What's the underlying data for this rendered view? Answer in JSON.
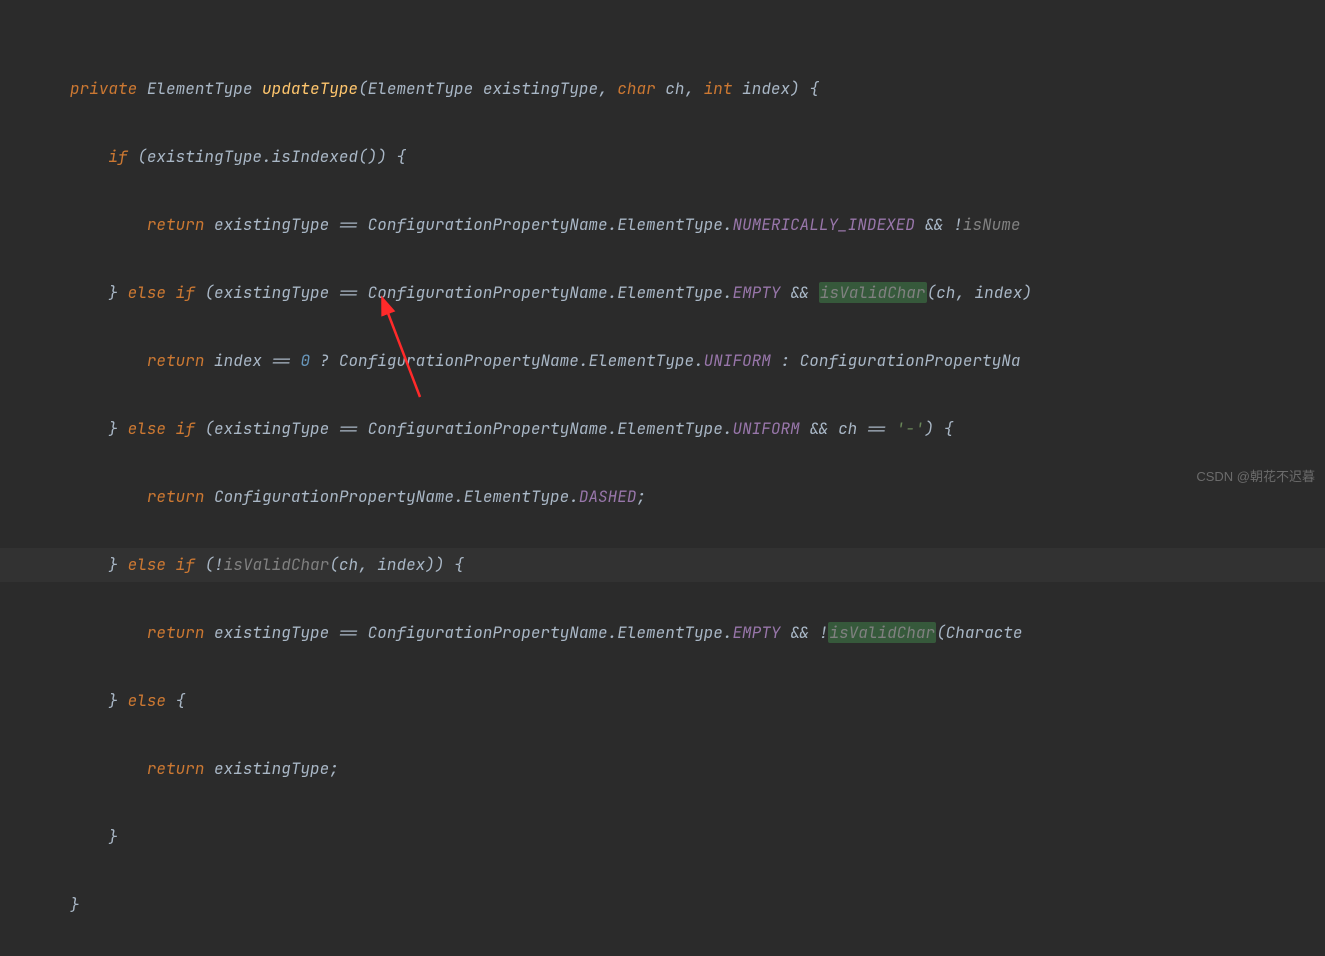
{
  "code": {
    "line1": {
      "kw_private": "private",
      "type1": "ElementType",
      "method": "updateType",
      "param_type1": "ElementType",
      "param_name1": "existingType",
      "kw_char": "char",
      "param_name2": "ch",
      "kw_int": "int",
      "param_name3": "index",
      "brace": "{"
    },
    "line2": {
      "kw_if": "if",
      "text": "(existingType.isIndexed()) {"
    },
    "line3": {
      "kw_return": "return",
      "text1": "existingType == ConfigurationPropertyName.ElementType.",
      "const1": "NUMERICALLY_INDEXED",
      "text2": " && !",
      "italic": "isNume"
    },
    "line4": {
      "brace_close": "}",
      "kw_else": "else",
      "kw_if": "if",
      "text1": "(existingType == ConfigurationPropertyName.ElementType.",
      "const1": "EMPTY",
      "text2": " && ",
      "hl_call": "isValidChar",
      "text3": "(ch, index)"
    },
    "line5": {
      "kw_return": "return",
      "text1": "index == ",
      "num": "0",
      "text2": " ? ConfigurationPropertyName.ElementType.",
      "const1": "UNIFORM",
      "text3": " : ConfigurationPropertyNa"
    },
    "line6": {
      "brace_close": "}",
      "kw_else": "else",
      "kw_if": "if",
      "text1": "(existingType == ConfigurationPropertyName.ElementType.",
      "const1": "UNIFORM",
      "text2": " && ch == ",
      "str": "'-'",
      "text3": ") {"
    },
    "line7": {
      "kw_return": "return",
      "text1": "ConfigurationPropertyName.ElementType.",
      "const1": "DASHED",
      "semi": ";"
    },
    "line8": {
      "brace_close": "}",
      "kw_else": "else",
      "kw_if": "if",
      "text1": "(!",
      "italic": "isValidChar",
      "text2": "(ch, index)) {"
    },
    "line9": {
      "kw_return": "return",
      "text1": "existingType == ConfigurationPropertyName.ElementType.",
      "const1": "EMPTY",
      "text2": " && !",
      "hl_call": "isValidChar",
      "text3": "(Characte"
    },
    "line10": {
      "brace_close": "}",
      "kw_else": "else",
      "brace_open": "{"
    },
    "line11": {
      "kw_return": "return",
      "text": "existingType;"
    },
    "line12": {
      "brace": "}"
    },
    "line13": {
      "brace": "}"
    }
  },
  "watermark": "CSDN @朝花不迟暮"
}
